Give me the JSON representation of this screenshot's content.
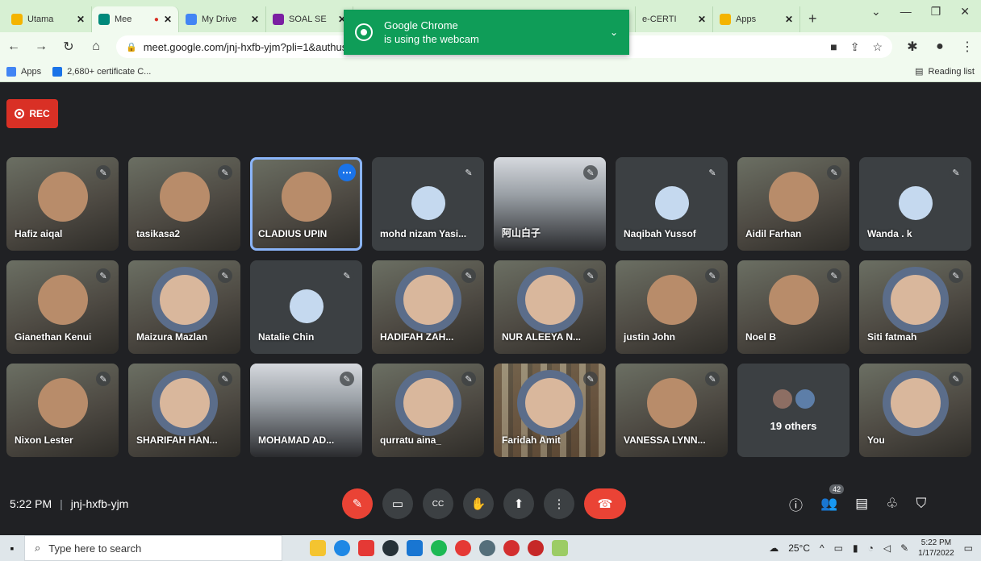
{
  "browser": {
    "tabs": [
      {
        "title": "Utama",
        "color": "#f4b400"
      },
      {
        "title": "Mee",
        "color": "#00897b",
        "active": true
      },
      {
        "title": "My Drive",
        "color": "#4285f4"
      },
      {
        "title": "SOAL SE",
        "color": "#7b1fa2"
      },
      {
        "title": "e-CERTI",
        "color": "#1a73e8"
      },
      {
        "title": "Apps",
        "color": "#f4b400"
      }
    ],
    "new_tab": "+",
    "url": "meet.google.com/jnj-hxfb-yjm?pli=1&authuser",
    "bookmarks": {
      "apps": "Apps",
      "certificate": "2,680+ certificate C...",
      "reading_list": "Reading list"
    }
  },
  "popup": {
    "title": "Google Chrome",
    "subtitle": "is using the webcam"
  },
  "meet": {
    "rec_label": "REC",
    "time": "5:22 PM",
    "meeting_code": "jnj-hxfb-yjm",
    "people_count": "42",
    "participants": [
      {
        "name": "Hafiz aiqal",
        "kind": "video"
      },
      {
        "name": "tasikasa2",
        "kind": "video"
      },
      {
        "name": "CLADIUS UPIN",
        "kind": "video",
        "active": true
      },
      {
        "name": "mohd nizam Yasi...",
        "kind": "avatar"
      },
      {
        "name": "阿山白子",
        "kind": "room"
      },
      {
        "name": "Naqibah Yussof",
        "kind": "avatar"
      },
      {
        "name": "Aidil Farhan",
        "kind": "video"
      },
      {
        "name": "Wanda . k",
        "kind": "avatar"
      },
      {
        "name": "Gianethan Kenui",
        "kind": "video"
      },
      {
        "name": "Maizura Mazlan",
        "kind": "hijab"
      },
      {
        "name": "Natalie Chin",
        "kind": "avatar"
      },
      {
        "name": "HADIFAH ZAH...",
        "kind": "hijab"
      },
      {
        "name": "NUR ALEEYA N...",
        "kind": "hijab"
      },
      {
        "name": "justin John",
        "kind": "video"
      },
      {
        "name": "Noel B",
        "kind": "video"
      },
      {
        "name": "Siti fatmah",
        "kind": "hijab"
      },
      {
        "name": "Nixon Lester",
        "kind": "video"
      },
      {
        "name": "SHARIFAH HAN...",
        "kind": "hijab"
      },
      {
        "name": "MOHAMAD AD...",
        "kind": "room"
      },
      {
        "name": "qurratu aina_",
        "kind": "hijab"
      },
      {
        "name": "Faridah Amit",
        "kind": "shelf"
      },
      {
        "name": "VANESSA LYNN...",
        "kind": "video"
      },
      {
        "name": "19 others",
        "kind": "others"
      },
      {
        "name": "You",
        "kind": "hijab"
      }
    ]
  },
  "taskbar": {
    "search_placeholder": "Type here to search",
    "temperature": "25°C",
    "clock_time": "5:22 PM",
    "clock_date": "1/17/2022"
  }
}
